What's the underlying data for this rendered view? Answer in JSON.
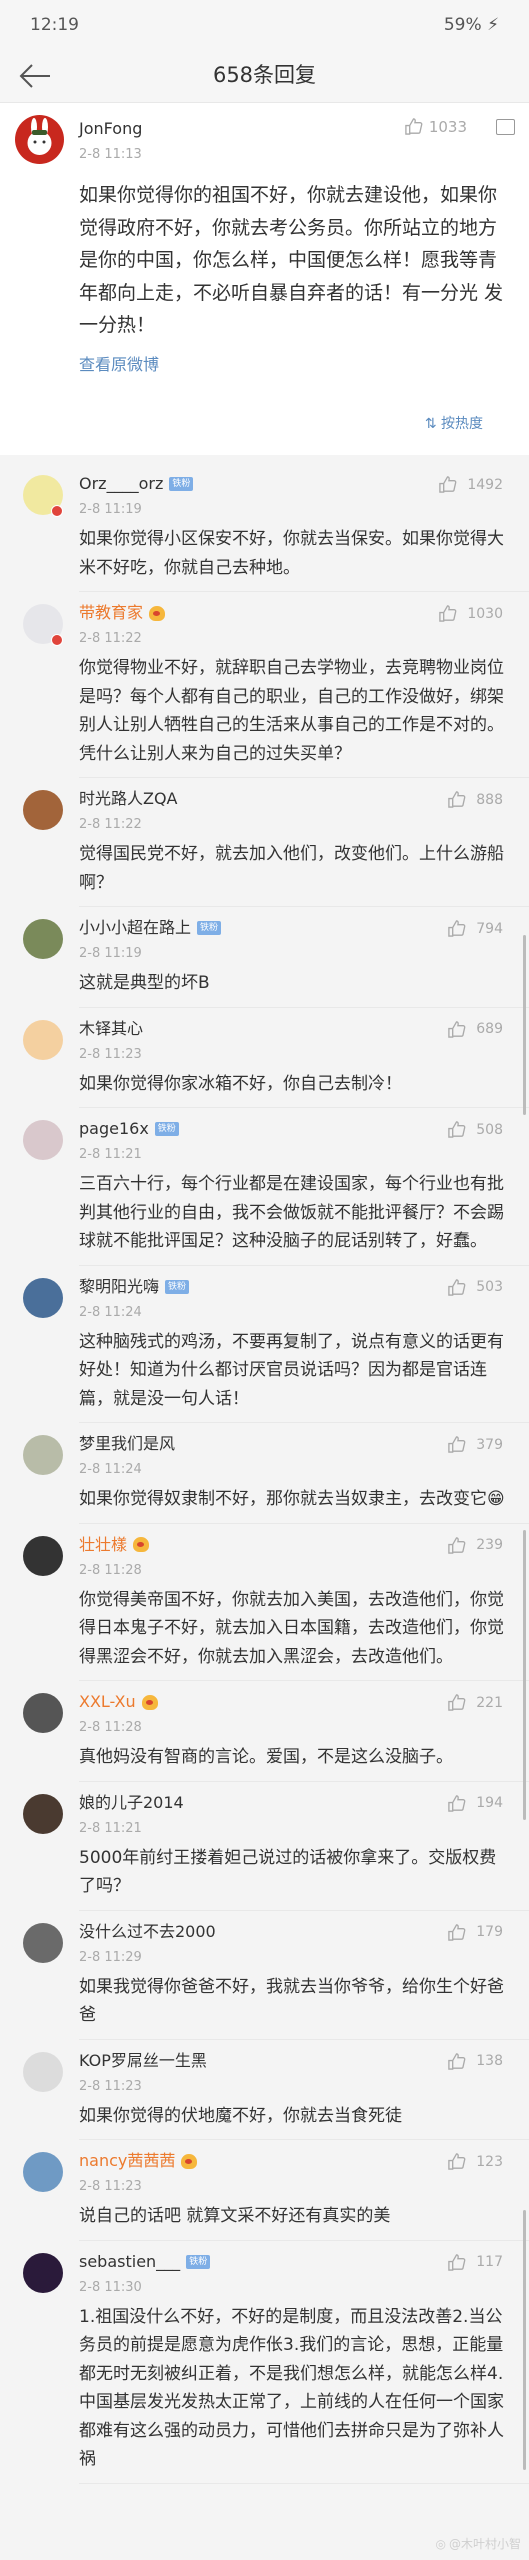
{
  "status_bar": {
    "time": "12:19",
    "battery": "59%"
  },
  "header": {
    "title": "658条回复"
  },
  "top_comment": {
    "name": "JonFong",
    "date": "2-8 11:13",
    "likes": "1033",
    "text": "如果你觉得你的祖国不好，你就去建设他，如果你觉得政府不好，你就去考公务员。你所站立的地方是你的中国，你怎么样，中国便怎么样！愿我等青年都向上走，不必听自暴自弃者的话！有一分光 发一分热！",
    "view_original": "查看原微博",
    "sort": "按热度"
  },
  "badge_label": "铁粉",
  "comments": [
    {
      "name": "Orz____orz",
      "badge": "tie",
      "date": "2-8 11:19",
      "likes": "1492",
      "text": "如果你觉得小区保安不好，你就去当保安。如果你觉得大米不好吃，你就自己去种地。",
      "avatar": "#f1e9a0",
      "red": true
    },
    {
      "name": "带教育家",
      "badge": "vip",
      "date": "2-8 11:22",
      "likes": "1030",
      "text": "你觉得物业不好，就辞职自己去学物业，去竞聘物业岗位是吗？每个人都有自己的职业，自己的工作没做好，绑架别人让别人牺牲自己的生活来从事自己的工作是不对的。凭什么让别人来为自己的过失买单？",
      "avatar": "#e6e6ea",
      "red": true
    },
    {
      "name": "时光路人ZQA",
      "badge": "",
      "date": "2-8 11:22",
      "likes": "888",
      "text": "觉得国民党不好，就去加入他们，改变他们。上什么游船啊？",
      "avatar": "#a2643a"
    },
    {
      "name": "小小小超在路上",
      "badge": "tie",
      "date": "2-8 11:19",
      "likes": "794",
      "text": "这就是典型的坏B",
      "avatar": "#7a8a5a"
    },
    {
      "name": "木铎其心",
      "badge": "",
      "date": "2-8 11:23",
      "likes": "689",
      "text": "如果你觉得你家冰箱不好，你自己去制冷！",
      "avatar": "#f4d0a0"
    },
    {
      "name": "page16x",
      "badge": "tie",
      "date": "2-8 11:21",
      "likes": "508",
      "text": "三百六十行，每个行业都是在建设国家，每个行业也有批判其他行业的自由，我不会做饭就不能批评餐厅？不会踢球就不能批评国足？这种没脑子的屁话别转了，好蠢。",
      "avatar": "#d9c8cc"
    },
    {
      "name": "黎明阳光嗨",
      "badge": "tie",
      "date": "2-8 11:24",
      "likes": "503",
      "text": "这种脑残式的鸡汤，不要再复制了，说点有意义的话更有好处！知道为什么都讨厌官员说话吗？因为都是官话连篇，就是没一句人话！",
      "avatar": "#4a6f9a"
    },
    {
      "name": "梦里我们是风",
      "badge": "",
      "date": "2-8 11:24",
      "likes": "379",
      "text": "如果你觉得奴隶制不好，那你就去当奴隶主，去改变它😁",
      "avatar": "#b8bca8"
    },
    {
      "name": "壮壮樣",
      "badge": "vip",
      "date": "2-8 11:28",
      "likes": "239",
      "text": "你觉得美帝国不好，你就去加入美国，去改造他们，你觉得日本鬼子不好，就去加入日本国籍，去改造他们，你觉得黑涩会不好，你就去加入黑涩会，去改造他们。",
      "avatar": "#333"
    },
    {
      "name": "XXL-Xu",
      "badge": "vip",
      "date": "2-8 11:28",
      "likes": "221",
      "text": "真他妈没有智商的言论。爱国，不是这么没脑子。",
      "avatar": "#555"
    },
    {
      "name": "娘的儿子2014",
      "badge": "",
      "date": "2-8 11:21",
      "likes": "194",
      "text": "5000年前纣王搂着妲己说过的话被你拿来了。交版权费了吗？",
      "avatar": "#4a3a30"
    },
    {
      "name": "没什么过不去2000",
      "badge": "",
      "date": "2-8 11:29",
      "likes": "179",
      "text": "如果我觉得你爸爸不好，我就去当你爷爷，给你生个好爸爸",
      "avatar": "#6a6a6a"
    },
    {
      "name": "KOP罗屌丝一生黑",
      "badge": "",
      "date": "2-8 11:23",
      "likes": "138",
      "text": "如果你觉得的伏地魔不好，你就去当食死徒",
      "avatar": "#dcdcdc"
    },
    {
      "name": "nancy茜茜茜",
      "badge": "vip",
      "date": "2-8 11:23",
      "likes": "123",
      "text": "说自己的话吧 就算文采不好还有真实的美",
      "avatar": "#6f9ac4"
    },
    {
      "name": "sebastien___",
      "badge": "tie",
      "date": "2-8 11:30",
      "likes": "117",
      "text": "1.祖国没什么不好，不好的是制度，而且没法改善2.当公务员的前提是愿意为虎作伥3.我们的言论，思想，正能量都无时无刻被纠正着，不是我们想怎么样，就能怎么样4.中国基层发光发热太正常了，上前线的人在任何一个国家都难有这么强的动员力，可惜他们去拼命只是为了弥补人祸",
      "avatar": "#2a1a3a"
    }
  ],
  "watermark": "@木叶村小智"
}
